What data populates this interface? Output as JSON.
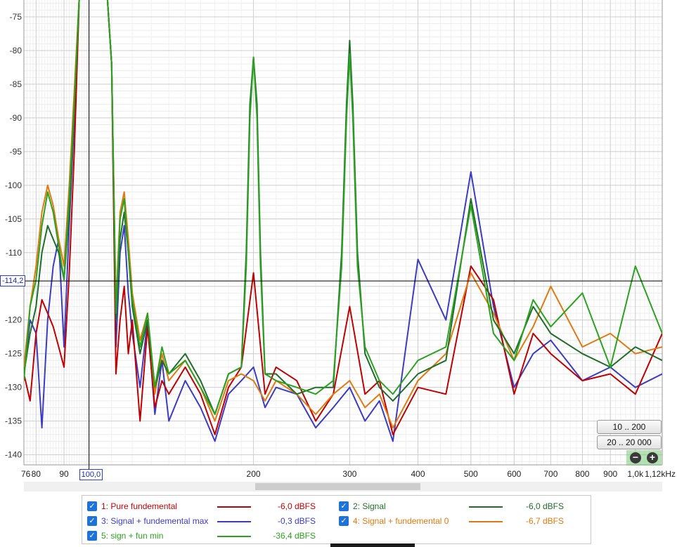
{
  "chart_data": {
    "type": "line",
    "xlabel": "",
    "ylabel": "",
    "x_scale": "log",
    "x_unit": "kHz",
    "xlim": [
      76,
      1120
    ],
    "ylim": [
      -141.5,
      -72.5
    ],
    "y_ticks": [
      -75,
      -80,
      -85,
      -90,
      -95,
      -100,
      -105,
      -110,
      -115,
      -120,
      -125,
      -130,
      -135,
      -140
    ],
    "y_tick_labels": [
      "-75",
      "-80",
      "-85",
      "-90",
      "-95",
      "-100",
      "-105",
      "-110",
      "",
      "-120",
      "-125",
      "-130",
      "-135",
      "-140"
    ],
    "x_ticks": [
      76,
      80,
      90,
      100,
      200,
      300,
      400,
      500,
      600,
      700,
      800,
      900,
      1000,
      1120
    ],
    "x_tick_labels": [
      "76",
      "80",
      "90",
      "",
      "200",
      "300",
      "400",
      "500",
      "600",
      "700",
      "800",
      "900",
      "1,0k",
      "1,12kHz"
    ],
    "grid": true,
    "cursor": {
      "x": 100,
      "y": -114.2,
      "x_label": "100,0",
      "y_label": "-114,2"
    },
    "zoom_presets": [
      "10 .. 200",
      "20 .. 20 000"
    ],
    "series": [
      {
        "name": "1: Pure fundemental",
        "level": "-6,0 dBFS",
        "color": "#c00000",
        "x": [
          76,
          78,
          80,
          82,
          84,
          86,
          88,
          90,
          92,
          94,
          96,
          98,
          100,
          102,
          104,
          106,
          108,
          110,
          112,
          114,
          116,
          118,
          120,
          124,
          128,
          132,
          136,
          140,
          150,
          160,
          170,
          180,
          190,
          200,
          210,
          220,
          240,
          260,
          280,
          300,
          320,
          340,
          360,
          400,
          450,
          500,
          550,
          600,
          650,
          700,
          800,
          900,
          1000,
          1120
        ],
        "y": [
          -128,
          -132,
          -122,
          -117,
          -119,
          -121,
          -124,
          -127,
          -113,
          -95,
          -72,
          -72,
          -72,
          -72,
          -72,
          -72,
          -72,
          -82,
          -128,
          -120,
          -115,
          -125,
          -120,
          -135,
          -121,
          -133,
          -129,
          -131,
          -127,
          -131,
          -137,
          -130,
          -127,
          -113,
          -131,
          -127,
          -129,
          -135,
          -131,
          -118,
          -131,
          -129,
          -137,
          -130,
          -131,
          -112,
          -117,
          -131,
          -122,
          -125,
          -129,
          -128,
          -131,
          -122
        ]
      },
      {
        "name": "2: Signal",
        "level": "-6,0 dBFS",
        "color": "#1e6e2a",
        "x": [
          76,
          78,
          80,
          82,
          84,
          86,
          88,
          90,
          92,
          94,
          96,
          98,
          100,
          102,
          104,
          106,
          108,
          110,
          112,
          114,
          116,
          118,
          120,
          124,
          128,
          132,
          136,
          140,
          150,
          160,
          170,
          180,
          190,
          194,
          197,
          200,
          203,
          206,
          210,
          220,
          240,
          260,
          280,
          290,
          296,
          300,
          304,
          310,
          320,
          340,
          360,
          400,
          450,
          500,
          550,
          600,
          650,
          700,
          800,
          900,
          1000,
          1120
        ],
        "y": [
          -128,
          -122,
          -118,
          -110,
          -106,
          -108,
          -110,
          -114,
          -104,
          -88,
          -72,
          -72,
          -72,
          -72,
          -72,
          -72,
          -72,
          -82,
          -120,
          -108,
          -104,
          -110,
          -118,
          -125,
          -120,
          -130,
          -126,
          -128,
          -125,
          -129,
          -134,
          -128,
          -127,
          -110,
          -88,
          -81,
          -88,
          -110,
          -128,
          -128,
          -131,
          -130,
          -130,
          -110,
          -88,
          -78.5,
          -88,
          -110,
          -125,
          -130,
          -132,
          -128,
          -126,
          -102,
          -120,
          -125,
          -118,
          -122,
          -125,
          -127,
          -124,
          -126
        ]
      },
      {
        "name": "3: Signal + fundemental max",
        "level": "-0,3 dBFS",
        "color": "#3b3bc4",
        "x": [
          76,
          78,
          80,
          82,
          84,
          86,
          88,
          90,
          92,
          94,
          96,
          98,
          100,
          102,
          104,
          106,
          108,
          110,
          112,
          114,
          116,
          118,
          120,
          124,
          128,
          132,
          136,
          140,
          150,
          160,
          170,
          180,
          190,
          200,
          210,
          220,
          240,
          260,
          280,
          300,
          320,
          340,
          360,
          400,
          450,
          500,
          550,
          600,
          650,
          700,
          800,
          900,
          1000,
          1120
        ],
        "y": [
          -128,
          -120,
          -122,
          -136,
          -120,
          -112,
          -108,
          -124,
          -106,
          -90,
          -72,
          -72,
          -72,
          -72,
          -72,
          -72,
          -72,
          -82,
          -124,
          -110,
          -106,
          -116,
          -122,
          -130,
          -120,
          -134,
          -126,
          -135,
          -129,
          -133,
          -138,
          -131,
          -129,
          -127,
          -133,
          -130,
          -131,
          -136,
          -133,
          -130,
          -135,
          -132,
          -138,
          -111,
          -120,
          -98,
          -118,
          -130,
          -125,
          -123,
          -129,
          -127,
          -130,
          -128
        ]
      },
      {
        "name": "4: Signal + fundemental 0",
        "level": "-6,7 dBFS",
        "color": "#e07a10",
        "x": [
          76,
          78,
          80,
          82,
          84,
          86,
          88,
          90,
          92,
          94,
          96,
          98,
          100,
          102,
          104,
          106,
          108,
          110,
          112,
          114,
          116,
          118,
          120,
          124,
          128,
          132,
          136,
          140,
          150,
          160,
          170,
          180,
          190,
          200,
          210,
          220,
          240,
          260,
          280,
          300,
          320,
          340,
          360,
          400,
          450,
          500,
          550,
          600,
          650,
          700,
          800,
          900,
          1000,
          1120
        ],
        "y": [
          -127,
          -118,
          -112,
          -104,
          -100,
          -103,
          -108,
          -112,
          -100,
          -86,
          -72,
          -72,
          -72,
          -72,
          -72,
          -72,
          -72,
          -82,
          -118,
          -104,
          -101,
          -108,
          -116,
          -123,
          -119,
          -131,
          -125,
          -129,
          -126,
          -130,
          -135,
          -129,
          -128,
          -129,
          -132,
          -129,
          -131,
          -134,
          -131,
          -129,
          -133,
          -131,
          -136,
          -129,
          -125,
          -113,
          -119,
          -126,
          -121,
          -115,
          -124,
          -122,
          -125,
          -124
        ]
      },
      {
        "name": "5: sign + fun min",
        "level": "-36,4 dBFS",
        "color": "#2aa21f",
        "x": [
          76,
          78,
          80,
          82,
          84,
          86,
          88,
          90,
          92,
          94,
          96,
          98,
          100,
          102,
          104,
          106,
          108,
          110,
          112,
          114,
          116,
          118,
          120,
          124,
          128,
          132,
          136,
          140,
          150,
          160,
          170,
          180,
          190,
          194,
          197,
          200,
          203,
          206,
          210,
          220,
          240,
          260,
          280,
          290,
          296,
          300,
          304,
          310,
          320,
          340,
          360,
          400,
          450,
          500,
          550,
          600,
          650,
          700,
          800,
          900,
          1000,
          1120
        ],
        "y": [
          -129,
          -118,
          -114,
          -106,
          -101,
          -104,
          -109,
          -114,
          -102,
          -88,
          -72,
          -72,
          -72,
          -72,
          -72,
          -72,
          -72,
          -82,
          -119,
          -105,
          -102,
          -110,
          -117,
          -124,
          -119,
          -130,
          -124,
          -128,
          -126,
          -130,
          -134,
          -128,
          -127,
          -112,
          -90,
          -81,
          -90,
          -112,
          -128,
          -129,
          -130,
          -131,
          -129,
          -112,
          -90,
          -80.5,
          -90,
          -112,
          -124,
          -129,
          -131,
          -126,
          -124,
          -103,
          -122,
          -126,
          -117,
          -121,
          -116,
          -127,
          -112,
          -122
        ]
      }
    ]
  }
}
